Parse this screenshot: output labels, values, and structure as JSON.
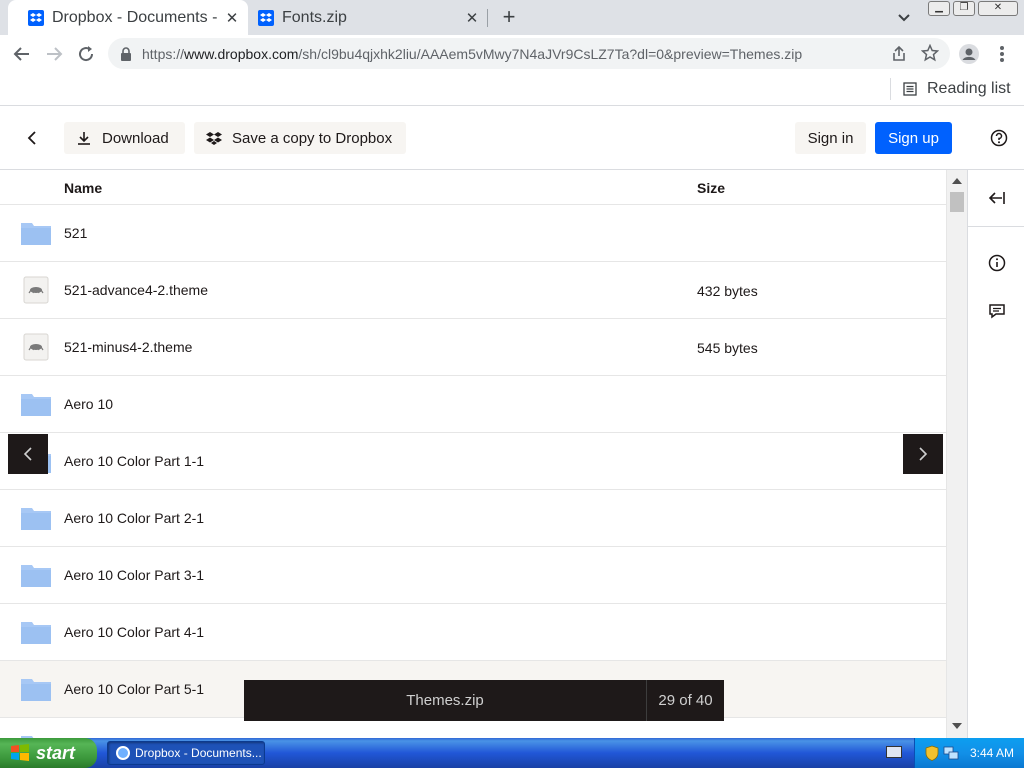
{
  "browser": {
    "tabs": [
      {
        "title": "Dropbox - Documents - S",
        "active": true
      },
      {
        "title": "Fonts.zip",
        "active": false
      }
    ],
    "new_tab": "+",
    "url_prefix": "https://",
    "url_host": "www.dropbox.com",
    "url_path": "/sh/cl9bu4qjxhk2liu/AAAem5vMwy7N4aJVr9CsLZ7Ta?dl=0&preview=Themes.zip",
    "reading_list": "Reading list"
  },
  "header": {
    "download": "Download",
    "save_copy": "Save a copy to Dropbox",
    "sign_in": "Sign in",
    "sign_up": "Sign up"
  },
  "list": {
    "col_name": "Name",
    "col_size": "Size",
    "rows": [
      {
        "name": "521",
        "size": "",
        "type": "folder"
      },
      {
        "name": "521-advance4-2.theme",
        "size": "432 bytes",
        "type": "theme"
      },
      {
        "name": "521-minus4-2.theme",
        "size": "545 bytes",
        "type": "theme"
      },
      {
        "name": "Aero 10",
        "size": "",
        "type": "folder"
      },
      {
        "name": "Aero 10 Color Part 1-1",
        "size": "",
        "type": "folder"
      },
      {
        "name": "Aero 10 Color Part 2-1",
        "size": "",
        "type": "folder"
      },
      {
        "name": "Aero 10 Color Part 3-1",
        "size": "",
        "type": "folder"
      },
      {
        "name": "Aero 10 Color Part 4-1",
        "size": "",
        "type": "folder"
      },
      {
        "name": "Aero 10 Color Part 5-1",
        "size": "",
        "type": "folder"
      }
    ]
  },
  "preview": {
    "filename": "Themes.zip",
    "counter": "29 of 40"
  },
  "taskbar": {
    "start": "start",
    "task": "Dropbox - Documents...",
    "clock": "3:44 AM"
  },
  "colors": {
    "accent": "#0061fe",
    "folder": "#a7c8f5",
    "preview_bar": "#1e1919"
  }
}
